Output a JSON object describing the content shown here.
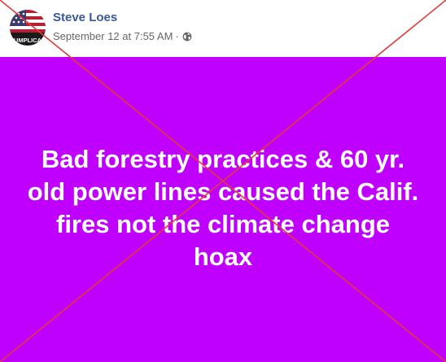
{
  "post": {
    "author": "Steve Loes",
    "timestamp": "September 12 at 7:55 AM",
    "separator": "·",
    "privacy_icon": "globe-icon",
    "avatar": {
      "badge_text": "RUMPLICAN",
      "icon": "american-flag-avatar"
    }
  },
  "image": {
    "background_color": "#c000ff",
    "text": "Bad forestry practices & 60 yr. old power lines caused the Calif. fires not the climate change hoax",
    "text_color": "#ffffff"
  },
  "overlay": {
    "type": "red-x-cross",
    "color": "#e53935"
  },
  "colors": {
    "author_link": "#385898",
    "meta_text": "#65676b"
  }
}
